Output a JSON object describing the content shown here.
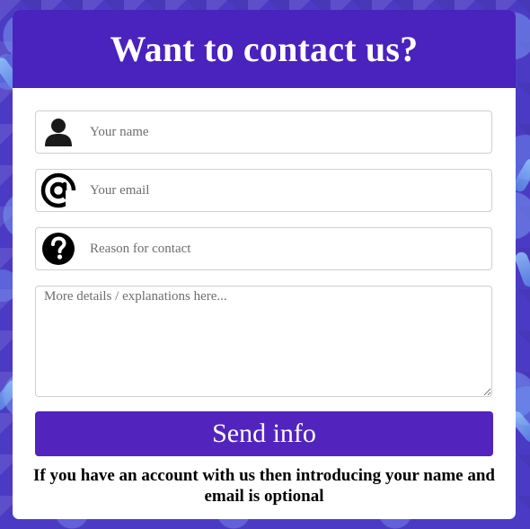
{
  "header": {
    "title": "Want to contact us?"
  },
  "form": {
    "name_field": {
      "placeholder": "Your name",
      "icon": "person-icon"
    },
    "email_field": {
      "placeholder": "Your email",
      "icon": "at-sign-icon"
    },
    "reason_field": {
      "placeholder": "Reason for contact",
      "icon": "question-mark-icon"
    },
    "details_field": {
      "placeholder": "More details / explanations here..."
    },
    "submit_label": "Send info"
  },
  "footer": {
    "note": "If you have an account with us then introducing your name and email is optional"
  },
  "colors": {
    "header_bg": "#4a22bd",
    "button_bg": "#5323bd",
    "page_bg": "#4b3bc4"
  }
}
